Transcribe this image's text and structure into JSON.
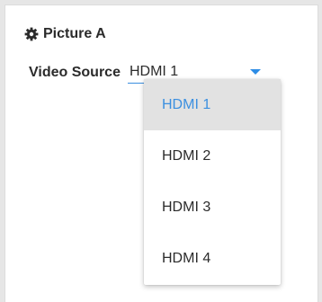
{
  "panel": {
    "title": "Picture A",
    "icon": "gear-icon"
  },
  "video_source": {
    "label": "Video Source",
    "selected": "HDMI 1",
    "options": [
      "HDMI 1",
      "HDMI 2",
      "HDMI 3",
      "HDMI 4"
    ]
  },
  "colors": {
    "accent": "#3b8fe0",
    "selected_bg": "#e2e2e2",
    "text": "#2b2b2b"
  }
}
